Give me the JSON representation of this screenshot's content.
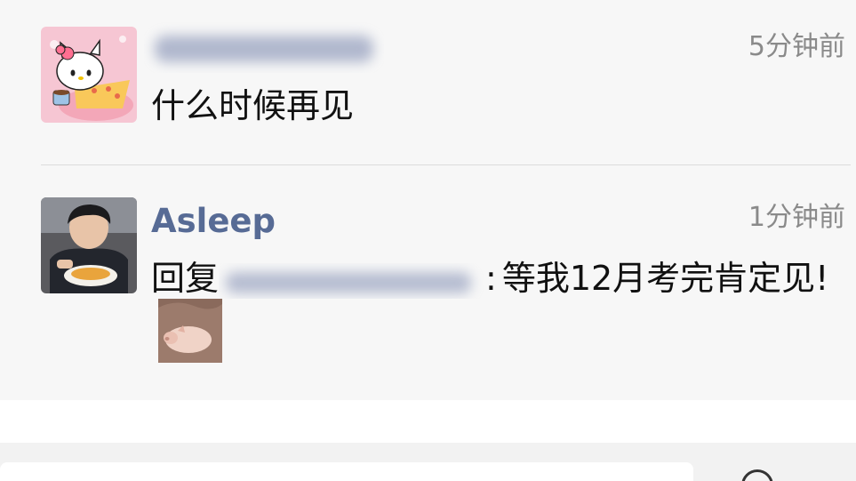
{
  "comments": [
    {
      "username": "",
      "time": "5分钟前",
      "text": "什么时候再见",
      "avatar_icon": "hello-kitty-avatar"
    },
    {
      "username": "Asleep",
      "time": "1分钟前",
      "reply_prefix": "回复",
      "text": "等我12月考完肯定见!",
      "avatar_icon": "boy-eating-avatar",
      "attachment_icon": "sleeping-piglet-photo"
    }
  ],
  "colors": {
    "username": "#576b95",
    "time": "#8a8a8a",
    "text": "#111111",
    "background": "#f7f7f7"
  }
}
